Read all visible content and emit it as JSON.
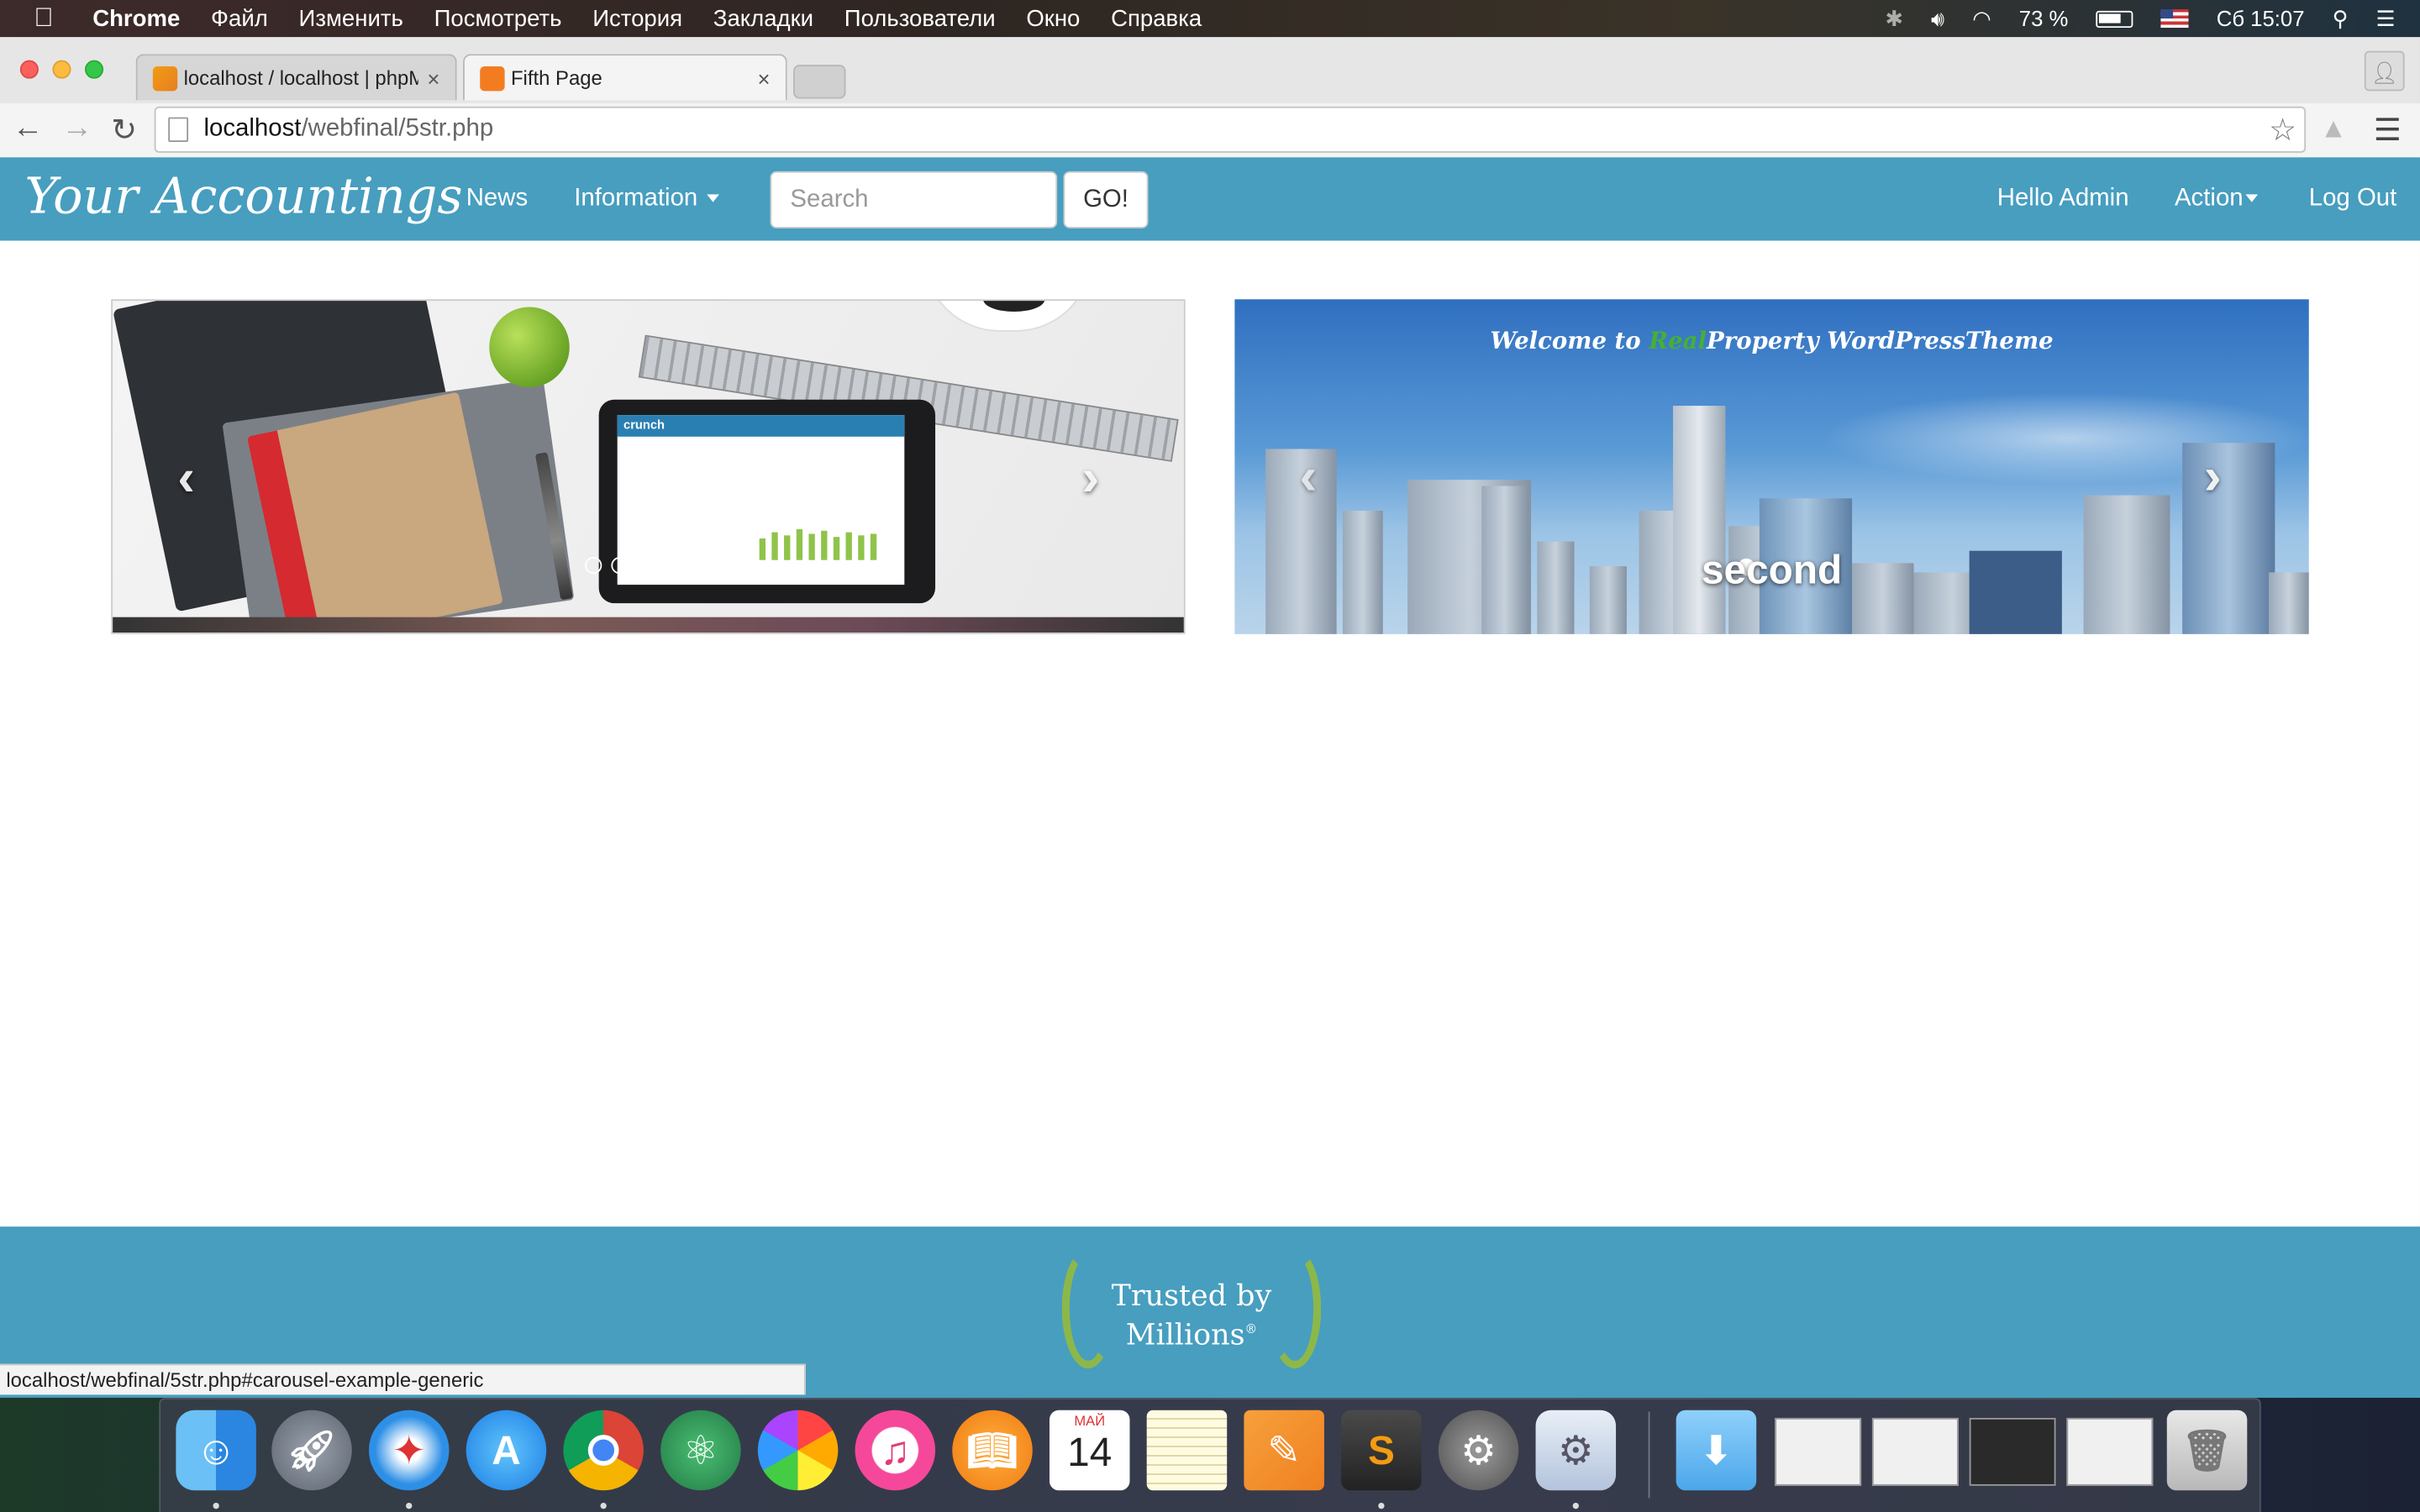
{
  "menubar": {
    "app": "Chrome",
    "items": [
      "Файл",
      "Изменить",
      "Посмотреть",
      "История",
      "Закладки",
      "Пользователи",
      "Окно",
      "Справка"
    ],
    "battery": "73 %",
    "clock": "Сб 15:07"
  },
  "tabs": [
    {
      "title": "localhost / localhost | phpMyAdmin",
      "close": "×"
    },
    {
      "title": "Fifth Page",
      "close": "×"
    }
  ],
  "address": {
    "host": "localhost",
    "path": "/webfinal/5str.php"
  },
  "navbar": {
    "brand": "Your Accountings",
    "news": "News",
    "information": "Information",
    "search_placeholder": "Search",
    "go": "GO!",
    "hello": "Hello Admin",
    "action": "Action",
    "logout": "Log Out"
  },
  "carousel1": {
    "tablet_brand": "crunch",
    "indicators": 5,
    "active_index": 2
  },
  "carousel2": {
    "welcome_pre": "Welcome to ",
    "welcome_green": "Real",
    "welcome_post": "Property WordPressTheme",
    "caption": "second"
  },
  "footer": {
    "trusted_line1": "Trusted by",
    "trusted_line2": "Millions",
    "mark": "®"
  },
  "statusbar": "localhost/webfinal/5str.php#carousel-example-generic",
  "dock": {
    "calendar_month": "МАЙ",
    "calendar_day": "14"
  },
  "colors": {
    "navbar": "#479ebf",
    "footer": "#479ebf"
  }
}
